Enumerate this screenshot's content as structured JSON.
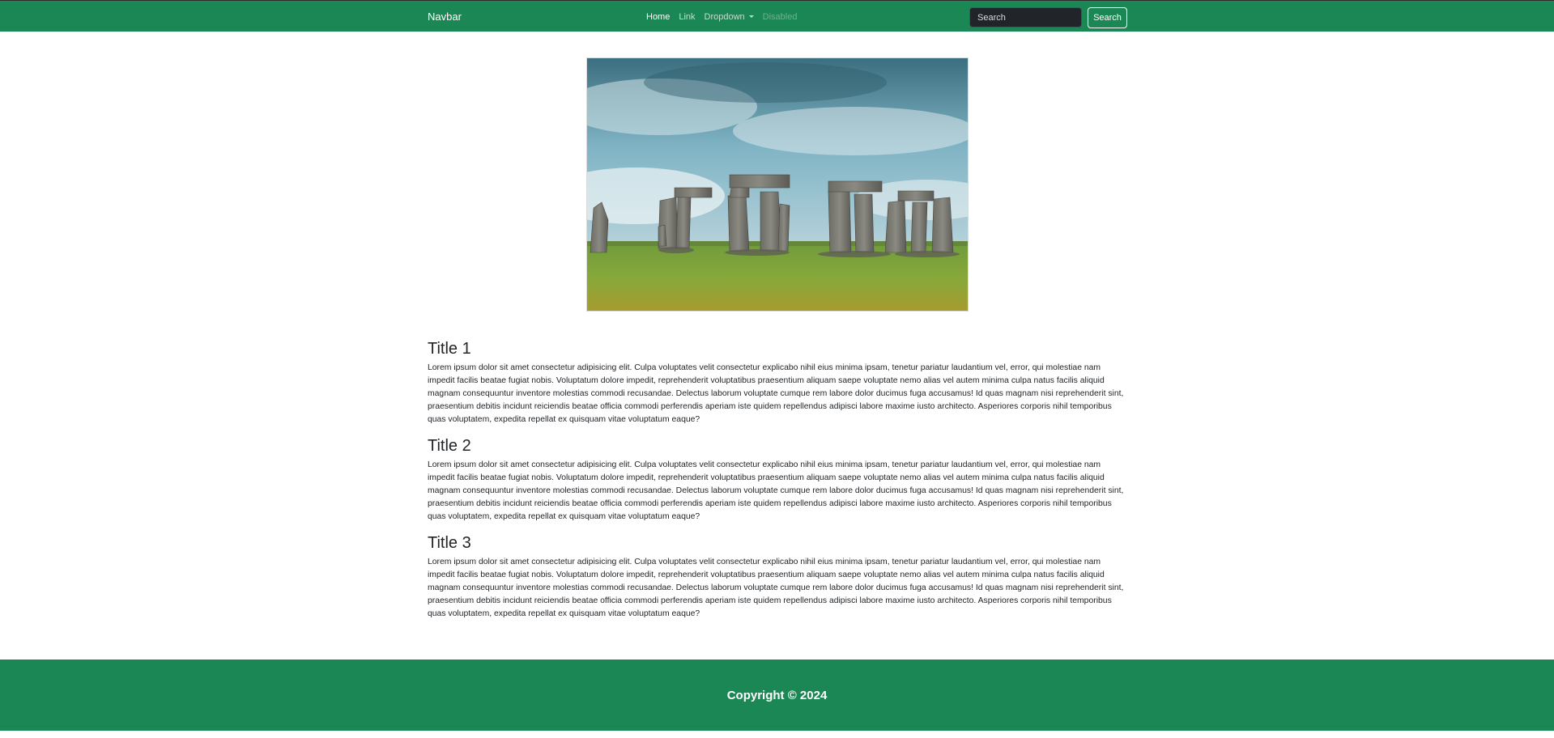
{
  "navbar": {
    "brand": "Navbar",
    "items": [
      {
        "label": "Home",
        "state": "active"
      },
      {
        "label": "Link",
        "state": "normal"
      },
      {
        "label": "Dropdown",
        "state": "dropdown"
      },
      {
        "label": "Disabled",
        "state": "disabled"
      }
    ],
    "search_placeholder": "Search",
    "search_button": "Search"
  },
  "hero_image": {
    "alt": "Stonehenge"
  },
  "sections": [
    {
      "title": "Title 1",
      "body": "Lorem ipsum dolor sit amet consectetur adipisicing elit. Culpa voluptates velit consectetur explicabo nihil eius minima ipsam, tenetur pariatur laudantium vel, error, qui molestiae nam impedit facilis beatae fugiat nobis. Voluptatum dolore impedit, reprehenderit voluptatibus praesentium aliquam saepe voluptate nemo alias vel autem minima culpa natus facilis aliquid magnam consequuntur inventore molestias commodi recusandae. Delectus laborum voluptate cumque rem labore dolor ducimus fuga accusamus! Id quas magnam nisi reprehenderit sint, praesentium debitis incidunt reiciendis beatae officia commodi perferendis aperiam iste quidem repellendus adipisci labore maxime iusto architecto. Asperiores corporis nihil temporibus quas voluptatem, expedita repellat ex quisquam vitae voluptatum eaque?"
    },
    {
      "title": "Title 2",
      "body": "Lorem ipsum dolor sit amet consectetur adipisicing elit. Culpa voluptates velit consectetur explicabo nihil eius minima ipsam, tenetur pariatur laudantium vel, error, qui molestiae nam impedit facilis beatae fugiat nobis. Voluptatum dolore impedit, reprehenderit voluptatibus praesentium aliquam saepe voluptate nemo alias vel autem minima culpa natus facilis aliquid magnam consequuntur inventore molestias commodi recusandae. Delectus laborum voluptate cumque rem labore dolor ducimus fuga accusamus! Id quas magnam nisi reprehenderit sint, praesentium debitis incidunt reiciendis beatae officia commodi perferendis aperiam iste quidem repellendus adipisci labore maxime iusto architecto. Asperiores corporis nihil temporibus quas voluptatem, expedita repellat ex quisquam vitae voluptatum eaque?"
    },
    {
      "title": "Title 3",
      "body": "Lorem ipsum dolor sit amet consectetur adipisicing elit. Culpa voluptates velit consectetur explicabo nihil eius minima ipsam, tenetur pariatur laudantium vel, error, qui molestiae nam impedit facilis beatae fugiat nobis. Voluptatum dolore impedit, reprehenderit voluptatibus praesentium aliquam saepe voluptate nemo alias vel autem minima culpa natus facilis aliquid magnam consequuntur inventore molestias commodi recusandae. Delectus laborum voluptate cumque rem labore dolor ducimus fuga accusamus! Id quas magnam nisi reprehenderit sint, praesentium debitis incidunt reiciendis beatae officia commodi perferendis aperiam iste quidem repellendus adipisci labore maxime iusto architecto. Asperiores corporis nihil temporibus quas voluptatem, expedita repellat ex quisquam vitae voluptatum eaque?"
    }
  ],
  "footer": {
    "copyright": "Copyright © 2024"
  },
  "colors": {
    "brand_green": "#1b8754",
    "input_dark": "#212529",
    "text": "#212529"
  }
}
